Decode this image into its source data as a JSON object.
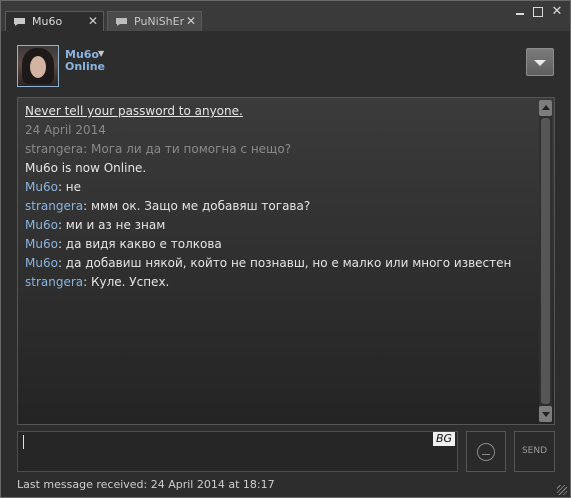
{
  "tabs": [
    {
      "label": "Mu6o",
      "close": "✕"
    },
    {
      "label": "PuNiShEr",
      "close": "✕"
    }
  ],
  "window_controls": {
    "close": "✕"
  },
  "user": {
    "name": "Mu6o",
    "status": "Online"
  },
  "chat": {
    "notice": "Never tell your password to anyone.",
    "date": "24 April 2014",
    "lines": [
      {
        "who": "strangera",
        "sep": ": ",
        "text": "Могa ли да ти помогна с нещо?"
      },
      {
        "who": "",
        "sep": "",
        "text": "Mu6o is now Online."
      },
      {
        "who": "Mu6o",
        "sep": ": ",
        "text": "не"
      },
      {
        "who": "strangera",
        "sep": ": ",
        "text": "ммм ок. Защо ме добавяш тогава?"
      },
      {
        "who": "Mu6o",
        "sep": ": ",
        "text": "ми и аз не знам"
      },
      {
        "who": "Mu6o",
        "sep": ": ",
        "text": "да видя какво е толкова"
      },
      {
        "who": "Mu6o",
        "sep": ": ",
        "text": "да добавиш някой, който не познавш, но е малко или много известен"
      },
      {
        "who": "strangera",
        "sep": ": ",
        "text": "Куле. Успех."
      }
    ]
  },
  "input": {
    "value": "",
    "language": "BG"
  },
  "send_label": "SEND",
  "footer": "Last message received: 24 April 2014 at 18:17"
}
